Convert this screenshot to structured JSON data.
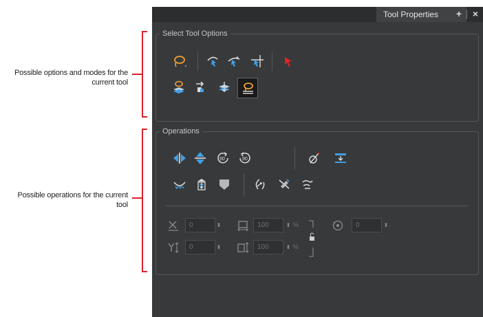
{
  "annotations": {
    "options_text": "Possible options and modes for the current tool",
    "operations_text": "Possible operations for the current tool",
    "bracket_color": "#d9222a"
  },
  "panel": {
    "tab_title": "Tool Properties",
    "tab_add_glyph": "+",
    "tab_close_glyph": "×"
  },
  "select_options": {
    "title": "Select Tool Options",
    "row1": [
      "lasso-icon",
      "select-by-bounding-box-icon",
      "snap-to-contour-icon",
      "snap-and-align-icon",
      "red-arrow-pointer-icon"
    ],
    "row2": [
      "apply-to-all-layers-icon",
      "select-layer-icon",
      "flatten-drawing-icon",
      "lasso-permanent-selection-icon"
    ],
    "selected": "lasso-permanent-selection-icon"
  },
  "operations": {
    "title": "Operations",
    "row1": [
      "flip-horizontal-icon",
      "flip-vertical-icon",
      "rotate-90-cw-icon",
      "rotate-90-ccw-icon",
      "pencil-to-brush-icon",
      "distribute-to-layer-icon"
    ],
    "row2": [
      "create-color-art-icon",
      "smooth-icon",
      "convert-to-brush-icon",
      "adjust-line-thickness-icon",
      "cut-selection-icon",
      "flatten-lines-icon"
    ],
    "x_value": "0",
    "y_value": "0",
    "width_value": "100",
    "height_value": "100",
    "angle_value": "0",
    "percent_symbol": "%",
    "spin_glyph": "⬍"
  },
  "colors": {
    "panel_bg": "#38393b",
    "accent_blue": "#3fa0e6",
    "accent_orange": "#f0a033",
    "accent_red": "#e02424"
  }
}
